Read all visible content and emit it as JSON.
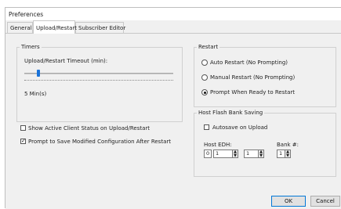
{
  "window": {
    "title": "Preferences"
  },
  "tabs": [
    {
      "label": "General",
      "active": false
    },
    {
      "label": "Upload/Restart",
      "active": true
    },
    {
      "label": "Subscriber Editor",
      "active": false
    }
  ],
  "timers": {
    "group_label": "Timers",
    "timeout_label": "Upload/Restart Timeout (min):",
    "slider_value_text": "5 Min(s)"
  },
  "options": {
    "show_active_client": {
      "label": "Show Active Client Status on Upload/Restart",
      "checked": false
    },
    "prompt_save": {
      "label": "Prompt to Save Modified Configuration After Restart",
      "checked": true
    }
  },
  "restart": {
    "group_label": "Restart",
    "options": [
      {
        "label": "Auto Restart (No Prompting)",
        "selected": false
      },
      {
        "label": "Manual Restart (No Prompting)",
        "selected": false
      },
      {
        "label": "Prompt When Ready to Restart",
        "selected": true
      }
    ]
  },
  "flash": {
    "group_label": "Host Flash Bank Saving",
    "autosave": {
      "label": "Autosave on Upload",
      "checked": false
    },
    "host_edh_label": "Host EDH:",
    "edh_prefix": "0",
    "edh_value_1": "1",
    "edh_value_2": "1",
    "bank_label": "Bank #:",
    "bank_value": "1"
  },
  "buttons": {
    "ok": "OK",
    "cancel": "Cancel"
  },
  "icons": {
    "check": "✓",
    "spin_up": "▲",
    "spin_down": "▼"
  }
}
